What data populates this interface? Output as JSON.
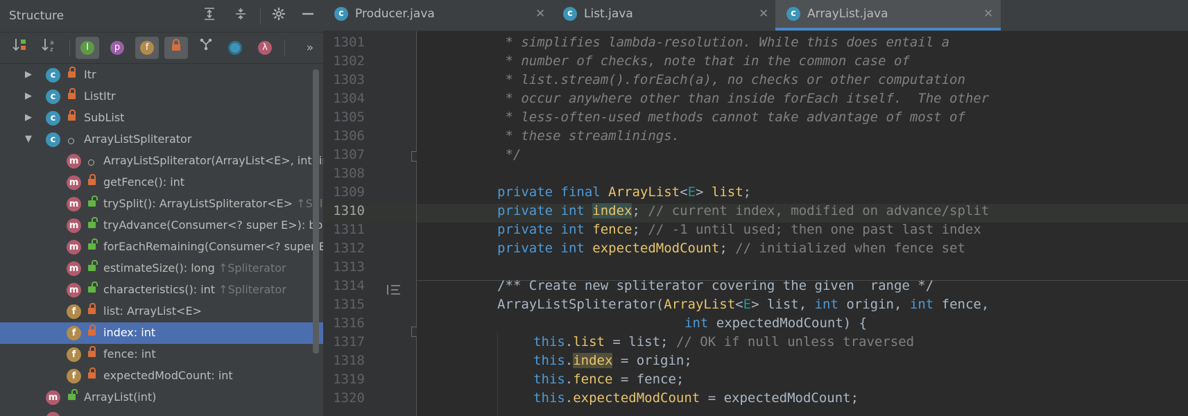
{
  "structure": {
    "title": "Structure",
    "tree": [
      {
        "label": "Itr",
        "icon": "c",
        "lock": "orange",
        "arrow": "▶",
        "indent": 0
      },
      {
        "label": "ListItr",
        "icon": "c",
        "lock": "orange",
        "arrow": "▶",
        "indent": 0
      },
      {
        "label": "SubList",
        "icon": "c",
        "lock": "orange",
        "arrow": "▶",
        "indent": 0
      },
      {
        "label": "ArrayListSpliterator",
        "icon": "c",
        "lock": "dot",
        "arrow": "▼",
        "indent": 0
      },
      {
        "label": "ArrayListSpliterator(ArrayList<E>, int, int, int)",
        "icon": "m",
        "lock": "dot",
        "indent": 1
      },
      {
        "label": "getFence(): int",
        "icon": "m",
        "lock": "orange",
        "indent": 1
      },
      {
        "label": "trySplit(): ArrayListSpliterator<E>",
        "suffix": " ↑Spliterator",
        "icon": "m",
        "lock": "green",
        "indent": 1
      },
      {
        "label": "tryAdvance(Consumer<? super E>): boolean",
        "icon": "m",
        "lock": "green",
        "indent": 1
      },
      {
        "label": "forEachRemaining(Consumer<? super E>): void",
        "icon": "m",
        "lock": "green",
        "indent": 1
      },
      {
        "label": "estimateSize(): long",
        "suffix": " ↑Spliterator",
        "icon": "m",
        "lock": "green",
        "indent": 1
      },
      {
        "label": "characteristics(): int",
        "suffix": " ↑Spliterator",
        "icon": "m",
        "lock": "green",
        "indent": 1
      },
      {
        "label": "list: ArrayList<E>",
        "icon": "f",
        "lock": "orange",
        "indent": 1
      },
      {
        "label": "index: int",
        "icon": "f",
        "lock": "orange",
        "indent": 1,
        "selected": true
      },
      {
        "label": "fence: int",
        "icon": "f",
        "lock": "orange",
        "indent": 1
      },
      {
        "label": "expectedModCount: int",
        "icon": "f",
        "lock": "orange",
        "indent": 1
      },
      {
        "label": "ArrayList(int)",
        "icon": "m",
        "lock": "green",
        "indent": 0
      }
    ]
  },
  "tabs": [
    {
      "name": "Producer.java",
      "active": false
    },
    {
      "name": "List.java",
      "active": false
    },
    {
      "name": "ArrayList.java",
      "active": true
    }
  ],
  "editor": {
    "current_line": "1310",
    "lines": [
      {
        "n": "1301"
      },
      {
        "n": "1302"
      },
      {
        "n": "1303"
      },
      {
        "n": "1304"
      },
      {
        "n": "1305"
      },
      {
        "n": "1306"
      },
      {
        "n": "1307"
      },
      {
        "n": "1308"
      },
      {
        "n": "1309"
      },
      {
        "n": "1310"
      },
      {
        "n": "1311"
      },
      {
        "n": "1312"
      },
      {
        "n": "1313"
      },
      {
        "n": "1314"
      },
      {
        "n": "1315"
      },
      {
        "n": "1316"
      },
      {
        "n": "1317"
      },
      {
        "n": "1318"
      },
      {
        "n": "1319"
      },
      {
        "n": "1320"
      }
    ],
    "code": {
      "l1301": " * simplifies lambda-resolution. While this does entail a",
      "l1302": " * number of checks, note that in the common case of",
      "l1303": " * list.stream().forEach(a), no checks or other computation",
      "l1304": " * occur anywhere other than inside forEach itself.  The other",
      "l1305": " * less-often-used methods cannot take advantage of most of",
      "l1306": " * these streamlinings.",
      "l1307": " */",
      "l1309_kw": "private final ",
      "l1309_type": "ArrayList",
      "l1309_lt": "<",
      "l1309_E": "E",
      "l1309_gt": "> ",
      "l1309_name": "list",
      "l1309_end": ";",
      "l1310_kw": "private int ",
      "l1310_name": "index",
      "l1310_end": "; ",
      "l1310_cm": "// current index, modified on advance/split",
      "l1311_kw": "private int ",
      "l1311_name": "fence",
      "l1311_end": "; ",
      "l1311_cm": "// -1 until used; then one past last index",
      "l1312_kw": "private int ",
      "l1312_name": "expectedModCount",
      "l1312_end": "; ",
      "l1312_cm": "// initialized when fence set",
      "l1314": "/** Create new spliterator covering the given  range */",
      "l1315_a": "ArrayListSpliterator(",
      "l1315_type": "ArrayList",
      "l1315_lt": "<",
      "l1315_E": "E",
      "l1315_b": "> list, ",
      "l1315_int1": "int",
      "l1315_c": " origin, ",
      "l1315_int2": "int",
      "l1315_d": " fence,",
      "l1316_int": "int",
      "l1316_rest": " expectedModCount) {",
      "l1317_this": "this",
      "l1317_dot": ".",
      "l1317_f": "list",
      "l1317_rest": " = list; ",
      "l1317_cm": "// OK if null unless traversed",
      "l1318_this": "this",
      "l1318_dot": ".",
      "l1318_f": "index",
      "l1318_rest": " = origin;",
      "l1319_this": "this",
      "l1319_dot": ".",
      "l1319_f": "fence",
      "l1319_rest": " = fence;",
      "l1320_this": "this",
      "l1320_dot": ".",
      "l1320_f": "expectedModCount",
      "l1320_rest": " = expectedModCount;"
    }
  }
}
